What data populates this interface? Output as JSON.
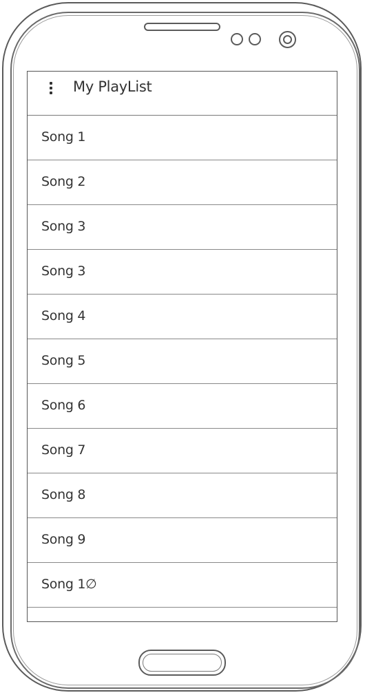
{
  "action_bar": {
    "menu_icon": "overflow-menu-icon",
    "title": "My PlayList"
  },
  "songs": [
    {
      "label": "Song 1"
    },
    {
      "label": "Song 2"
    },
    {
      "label": "Song 3"
    },
    {
      "label": "Song 3"
    },
    {
      "label": "Song 4"
    },
    {
      "label": "Song 5"
    },
    {
      "label": "Song 6"
    },
    {
      "label": "Song 7"
    },
    {
      "label": "Song 8"
    },
    {
      "label": "Song 9"
    },
    {
      "label": "Song 1∅"
    }
  ],
  "colors": {
    "outline": "#5a5a5a",
    "text": "#333333",
    "divider": "#888888"
  }
}
